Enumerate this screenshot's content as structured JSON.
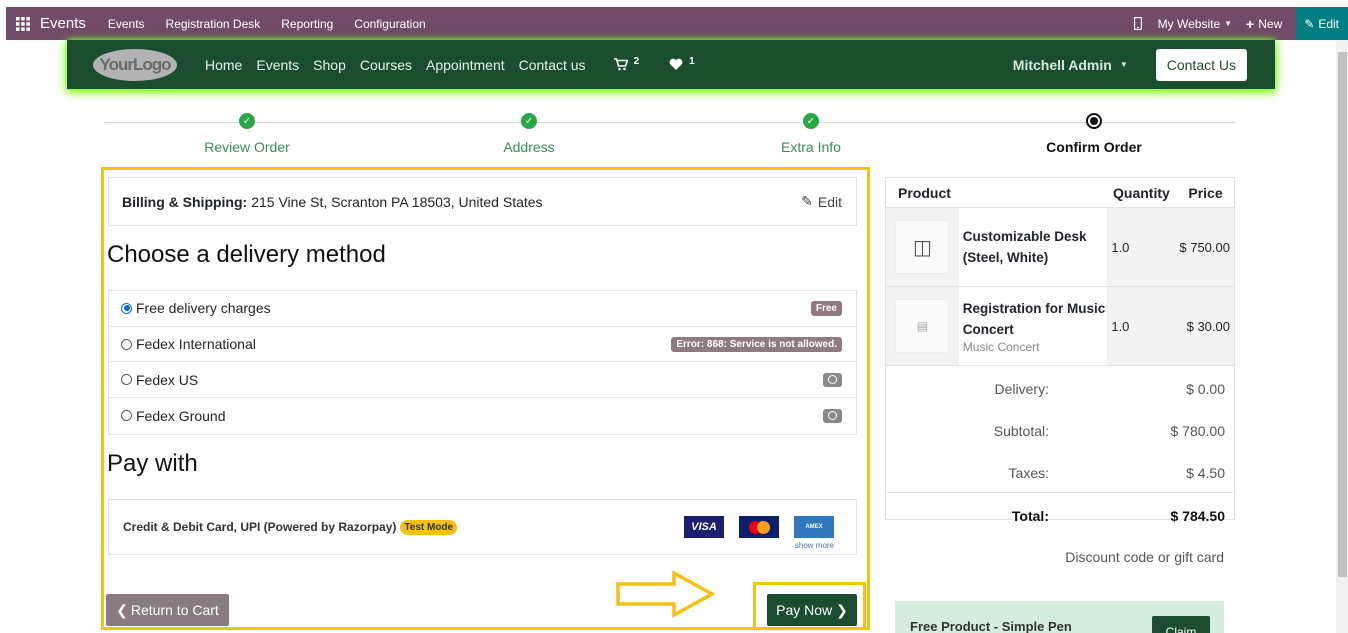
{
  "admin_bar": {
    "app_name": "Events",
    "menus": [
      "Events",
      "Registration Desk",
      "Reporting",
      "Configuration"
    ],
    "website_selector": "My Website",
    "new_label": "New",
    "edit_label": "Edit"
  },
  "header": {
    "logo_text": "YourLogo",
    "nav": [
      "Home",
      "Events",
      "Shop",
      "Courses",
      "Appointment",
      "Contact us"
    ],
    "cart_count": "2",
    "wishlist_count": "1",
    "user": "Mitchell Admin",
    "contact_button": "Contact Us"
  },
  "progress": {
    "steps": [
      "Review Order",
      "Address",
      "Extra Info",
      "Confirm Order"
    ],
    "current_index": 3
  },
  "billing": {
    "label": "Billing & Shipping:",
    "address": "215 Vine St, Scranton PA 18503, United States",
    "edit_label": "Edit"
  },
  "delivery": {
    "title": "Choose a delivery method",
    "options": [
      {
        "label": "Free delivery charges",
        "badge": "Free",
        "selected": true
      },
      {
        "label": "Fedex International",
        "badge": "Error: 868: Service is not allowed.",
        "selected": false
      },
      {
        "label": "Fedex US",
        "badge": "",
        "selected": false
      },
      {
        "label": "Fedex Ground",
        "badge": "",
        "selected": false
      }
    ]
  },
  "payment": {
    "title": "Pay with",
    "provider": "Credit & Debit Card, UPI (Powered by Razorpay)",
    "mode_badge": "Test Mode",
    "cards": [
      "VISA",
      "MasterCard",
      "AMERICAN EXPRESS"
    ],
    "show_more": "show more"
  },
  "actions": {
    "return_label": "Return to Cart",
    "pay_label": "Pay Now"
  },
  "summary": {
    "headers": [
      "Product",
      "Quantity",
      "Price"
    ],
    "items": [
      {
        "name": "Customizable Desk (Steel, White)",
        "sub": "",
        "qty": "1.0",
        "price": "$ 750.00"
      },
      {
        "name": "Registration for Music Concert",
        "sub": "Music Concert",
        "qty": "1.0",
        "price": "$ 30.00"
      }
    ],
    "delivery_label": "Delivery:",
    "delivery_value": "$ 0.00",
    "subtotal_label": "Subtotal:",
    "subtotal_value": "$ 780.00",
    "taxes_label": "Taxes:",
    "taxes_value": "$ 4.50",
    "total_label": "Total:",
    "total_value": "$ 784.50",
    "discount_link": "Discount code or gift card"
  },
  "promo": {
    "text": "Free Product - Simple Pen",
    "button": "Claim"
  },
  "colors": {
    "admin_bar": "#714b67",
    "website_header": "#1a4d2e",
    "highlight": "#f5c211",
    "success": "#28a745"
  }
}
